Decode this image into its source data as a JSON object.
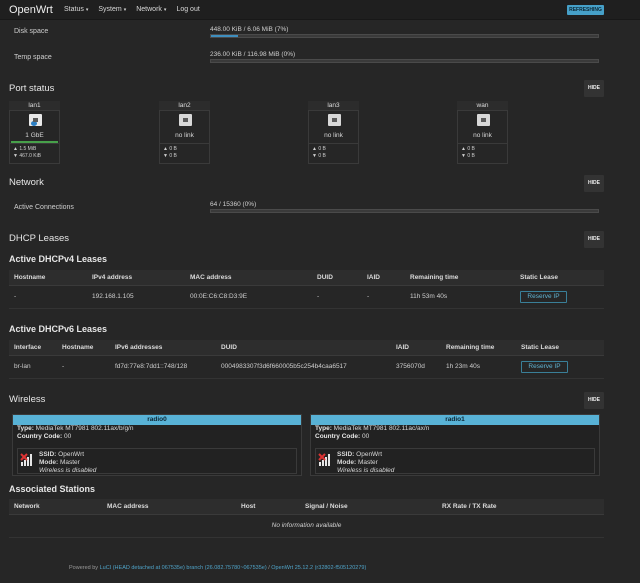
{
  "brand": "OpenWrt",
  "menu": [
    {
      "label": "Status",
      "caret": "▾"
    },
    {
      "label": "System",
      "caret": "▾"
    },
    {
      "label": "Network",
      "caret": "▾"
    },
    {
      "label": "Log out",
      "caret": ""
    }
  ],
  "refreshing": "REFRESHING",
  "storage": {
    "disk_label": "Disk space",
    "disk_value": "448.00 KiB / 6.06 MiB (7%)",
    "disk_fraction": 0.07,
    "temp_label": "Temp space",
    "temp_value": "236.00 KiB / 116.98 MiB (0%)",
    "temp_fraction": 0.0
  },
  "port_status": {
    "title": "Port status",
    "hide": "HIDE",
    "ports": [
      {
        "name": "lan1",
        "state": "1 GbE",
        "rx": "▲ 1.5 MiB",
        "tx": "▼ 467.0 KiB",
        "up": true
      },
      {
        "name": "lan2",
        "state": "no link",
        "rx": "▲ 0 B",
        "tx": "▼ 0 B",
        "up": false
      },
      {
        "name": "lan3",
        "state": "no link",
        "rx": "▲ 0 B",
        "tx": "▼ 0 B",
        "up": false
      },
      {
        "name": "wan",
        "state": "no link",
        "rx": "▲ 0 B",
        "tx": "▼ 0 B",
        "up": false
      }
    ]
  },
  "network": {
    "title": "Network",
    "hide": "HIDE",
    "conn_label": "Active Connections",
    "conn_value": "64 / 15360 (0%)",
    "conn_fraction": 0.0
  },
  "dhcp": {
    "title": "DHCP Leases",
    "hide": "HIDE",
    "v4_title": "Active DHCPv4 Leases",
    "v4_headers": [
      "Hostname",
      "IPv4 address",
      "MAC address",
      "DUID",
      "IAID",
      "Remaining time",
      "Static Lease"
    ],
    "v4_row": [
      "-",
      "192.168.1.105",
      "00:0E:C6:C8:D3:9E",
      "-",
      "-",
      "11h 53m 40s"
    ],
    "v4_button": "Reserve IP",
    "v6_title": "Active DHCPv6 Leases",
    "v6_headers": [
      "Interface",
      "Hostname",
      "IPv6 addresses",
      "DUID",
      "IAID",
      "Remaining time",
      "Static Lease"
    ],
    "v6_row": [
      "br-lan",
      "-",
      "fd7d:77e8:7dd1::748/128",
      "0004983307f3d6f660005b5c254b4caa6517",
      "3756070d",
      "1h 23m 40s"
    ],
    "v6_button": "Reserve IP"
  },
  "wireless": {
    "title": "Wireless",
    "hide": "HIDE",
    "radios": [
      {
        "name": "radio0",
        "type_label": "Type:",
        "type": "MediaTek MT7981 802.11ax/b/g/n",
        "cc_label": "Country Code:",
        "cc": "00",
        "ssid_label": "SSID:",
        "ssid": "OpenWrt",
        "mode_label": "Mode:",
        "mode": "Master",
        "status": "Wireless is disabled"
      },
      {
        "name": "radio1",
        "type_label": "Type:",
        "type": "MediaTek MT7981 802.11ac/ax/n",
        "cc_label": "Country Code:",
        "cc": "00",
        "ssid_label": "SSID:",
        "ssid": "OpenWrt",
        "mode_label": "Mode:",
        "mode": "Master",
        "status": "Wireless is disabled"
      }
    ]
  },
  "stations": {
    "title": "Associated Stations",
    "headers": [
      "Network",
      "MAC address",
      "Host",
      "Signal / Noise",
      "RX Rate / TX Rate"
    ],
    "empty": "No information available"
  },
  "footer": {
    "prefix": "Powered by ",
    "luci": "LuCI (HEAD detached at 067535e) branch (26.082.75780~067535e)",
    "sep": " / ",
    "openwrt": "OpenWrt 25.12.2 (r32802-f505120279)"
  },
  "colors": {
    "accent": "#58b2d6",
    "link_up": "#47a04a",
    "background": "#262626"
  }
}
